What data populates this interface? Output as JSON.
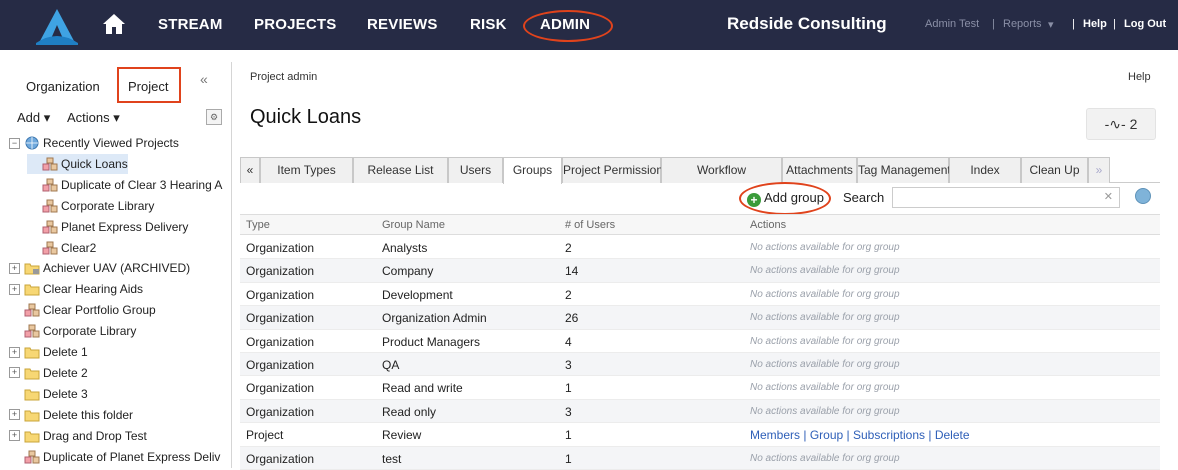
{
  "nav": {
    "links": [
      "STREAM",
      "PROJECTS",
      "REVIEWS",
      "RISK",
      "ADMIN"
    ],
    "company": "Redside Consulting",
    "user": "Admin Test",
    "sep1": "|",
    "reports": "Reports",
    "sep2": "|",
    "help": "Help",
    "sep3": "|",
    "logout": "Log Out"
  },
  "sidebar": {
    "tabs": [
      "Organization",
      "Project"
    ],
    "add_label": "Add ▾",
    "actions_label": "Actions ▾",
    "tree": [
      {
        "label": "Recently Viewed Projects",
        "icon": "globe-icon",
        "exp": "−",
        "indent": 0
      },
      {
        "label": "Quick Loans",
        "icon": "project-icon",
        "exp": "",
        "indent": 1,
        "selected": true
      },
      {
        "label": "Duplicate of Clear 3 Hearing A",
        "icon": "project-icon",
        "exp": "",
        "indent": 1
      },
      {
        "label": "Corporate Library",
        "icon": "project-icon",
        "exp": "",
        "indent": 1
      },
      {
        "label": "Planet Express Delivery",
        "icon": "project-icon",
        "exp": "",
        "indent": 1
      },
      {
        "label": "Clear2",
        "icon": "project-icon",
        "exp": "",
        "indent": 1
      },
      {
        "label": "Achiever UAV (ARCHIVED)",
        "icon": "archived-folder-icon",
        "exp": "+",
        "indent": 0
      },
      {
        "label": "Clear Hearing Aids",
        "icon": "folder-icon",
        "exp": "+",
        "indent": 0
      },
      {
        "label": "Clear Portfolio Group",
        "icon": "project-icon",
        "exp": "",
        "indent": 0
      },
      {
        "label": "Corporate Library",
        "icon": "project-icon",
        "exp": "",
        "indent": 0
      },
      {
        "label": "Delete 1",
        "icon": "folder-icon",
        "exp": "+",
        "indent": 0
      },
      {
        "label": "Delete 2",
        "icon": "folder-icon",
        "exp": "+",
        "indent": 0
      },
      {
        "label": "Delete 3",
        "icon": "folder-icon",
        "exp": "",
        "indent": 0
      },
      {
        "label": "Delete this folder",
        "icon": "folder-icon",
        "exp": "+",
        "indent": 0
      },
      {
        "label": "Drag and Drop Test",
        "icon": "folder-icon",
        "exp": "+",
        "indent": 0
      },
      {
        "label": "Duplicate of Planet Express Deliv",
        "icon": "project-icon",
        "exp": "",
        "indent": 0
      }
    ]
  },
  "main": {
    "breadcrumb": "Project admin",
    "help": "Help",
    "title": "Quick Loans",
    "pulse_count": "2",
    "tabs": [
      "Item Types",
      "Release List",
      "Users",
      "Groups",
      "Project Permissions",
      "Workflow",
      "Attachments",
      "Tag Management",
      "Index",
      "Clean Up"
    ],
    "active_tab": "Groups",
    "add_group": "Add group",
    "search_label": "Search",
    "search_value": "",
    "columns": [
      "Type",
      "Group Name",
      "# of Users",
      "Actions"
    ],
    "rows": [
      {
        "type": "Organization",
        "name": "Analysts",
        "users": "2",
        "actions": "No actions available for org group"
      },
      {
        "type": "Organization",
        "name": "Company",
        "users": "14",
        "actions": "No actions available for org group"
      },
      {
        "type": "Organization",
        "name": "Development",
        "users": "2",
        "actions": "No actions available for org group"
      },
      {
        "type": "Organization",
        "name": "Organization Admin",
        "users": "26",
        "actions": "No actions available for org group"
      },
      {
        "type": "Organization",
        "name": "Product Managers",
        "users": "4",
        "actions": "No actions available for org group"
      },
      {
        "type": "Organization",
        "name": "QA",
        "users": "3",
        "actions": "No actions available for org group"
      },
      {
        "type": "Organization",
        "name": "Read and write",
        "users": "1",
        "actions": "No actions available for org group"
      },
      {
        "type": "Organization",
        "name": "Read only",
        "users": "3",
        "actions": "No actions available for org group"
      },
      {
        "type": "Project",
        "name": "Review",
        "users": "1",
        "links": [
          "Members",
          "Group",
          "Subscriptions",
          "Delete"
        ]
      },
      {
        "type": "Organization",
        "name": "test",
        "users": "1",
        "actions": "No actions available for org group"
      }
    ]
  },
  "colors": {
    "nav_bg": "#262b45",
    "highlight_ring": "#e0431c",
    "link": "#2e5fb8"
  }
}
